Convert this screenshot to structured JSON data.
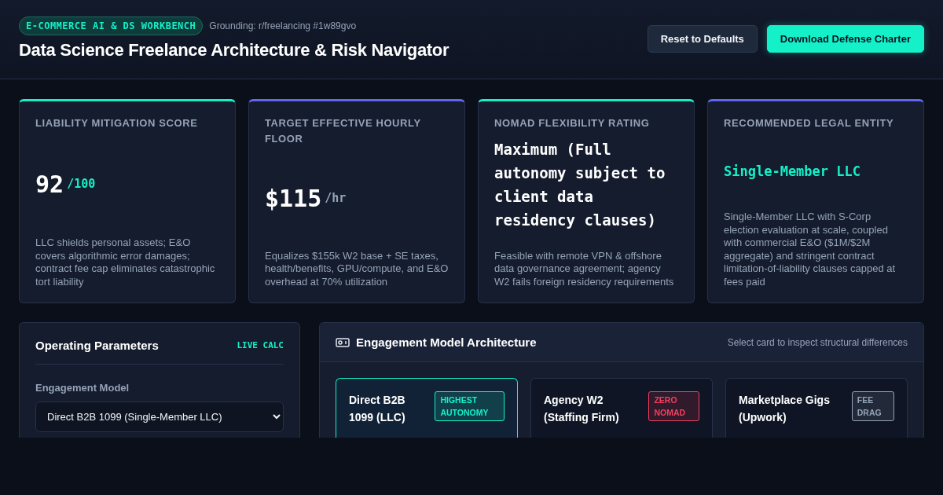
{
  "header": {
    "badge": "E-COMMERCE AI & DS WORKBENCH",
    "grounding": "Grounding: r/freelancing #1w89gvo",
    "title": "Data Science Freelance Architecture & Risk Navigator",
    "buttons": [
      {
        "label": "Reset to Defaults",
        "kind": "secondary"
      },
      {
        "label": "Download Defense Charter",
        "kind": "primary"
      }
    ]
  },
  "stats": [
    {
      "label": "LIABILITY MITIGATION SCORE",
      "kind": "score",
      "value": "92",
      "unit": "/100",
      "color": "#14f1c9",
      "description": "LLC shields personal assets; E&O covers algorithmic error damages; contract fee cap eliminates catastrophic tort liability"
    },
    {
      "label": "TARGET EFFECTIVE HOURLY FLOOR",
      "kind": "rate",
      "value": "$115",
      "unit": "/hr",
      "color": "#6366f1",
      "description": "Equalizes $155k W2 base + SE taxes, health/benefits, GPU/compute, and E&O overhead at 70% utilization"
    },
    {
      "label": "NOMAD FLEXIBILITY RATING",
      "kind": "rating",
      "value": "Maximum (Full autonomy subject to client data residency clauses)",
      "color": "#14f1c9",
      "description": "Feasible with remote VPN & offshore data governance agreement; agency W2 fails foreign residency requirements"
    },
    {
      "label": "RECOMMENDED LEGAL ENTITY",
      "kind": "entity",
      "value": "Single-Member LLC",
      "color": "#6366f1",
      "description": "Single-Member LLC with S-Corp election evaluation at scale, coupled with commercial E&O ($1M/$2M aggregate) and stringent contract limitation-of-liability clauses capped at fees paid"
    }
  ],
  "parameters": {
    "title": "Operating Parameters",
    "tag": "LIVE CALC",
    "field_label": "Engagement Model",
    "select_value": "Direct B2B 1099 (Single-Member LLC)"
  },
  "architecture": {
    "title": "Engagement Model Architecture",
    "hint": "Select card to inspect structural differences",
    "models": [
      {
        "name": "Direct B2B 1099 (LLC)",
        "badge": "HIGHEST AUTONOMY",
        "color": "#14f1c9",
        "selected": true
      },
      {
        "name": "Agency W2 (Staffing Firm)",
        "badge": "ZERO NOMAD",
        "color": "#f43f5e",
        "selected": false
      },
      {
        "name": "Marketplace Gigs (Upwork)",
        "badge": "FEE DRAG",
        "color": "#94a3b8",
        "selected": false
      }
    ]
  }
}
